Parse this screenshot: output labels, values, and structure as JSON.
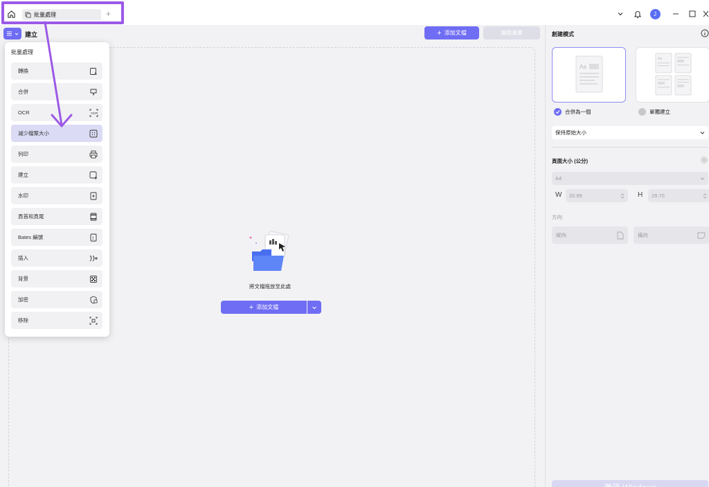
{
  "titlebar": {
    "tab_label": "批量處理",
    "tab_add": "+",
    "avatar_letter": "J"
  },
  "toolbar": {
    "page_title": "建立",
    "add_file_label": "添加文檔",
    "clear_list_label": "清除清單"
  },
  "dropzone": {
    "text": "將文檔拖放至此處",
    "add_file_label": "添加文檔"
  },
  "menu": {
    "header": "批量處理",
    "items": [
      {
        "label": "轉換",
        "icon": "convert-icon"
      },
      {
        "label": "合併",
        "icon": "merge-icon"
      },
      {
        "label": "OCR",
        "icon": "ocr-icon"
      },
      {
        "label": "減少檔案大小",
        "icon": "compress-icon"
      },
      {
        "label": "列印",
        "icon": "printer-icon"
      },
      {
        "label": "建立",
        "icon": "create-icon"
      },
      {
        "label": "水印",
        "icon": "watermark-icon"
      },
      {
        "label": "頁首和頁尾",
        "icon": "header-footer-icon"
      },
      {
        "label": "Bates 編號",
        "icon": "bates-icon"
      },
      {
        "label": "插入",
        "icon": "insert-icon"
      },
      {
        "label": "背景",
        "icon": "background-icon"
      },
      {
        "label": "加密",
        "icon": "encrypt-icon"
      },
      {
        "label": "移除",
        "icon": "remove-icon"
      }
    ],
    "active_index": 3
  },
  "right_panel": {
    "title": "創建模式",
    "merge_one_label": "合併為一個",
    "separate_label": "單獨建立",
    "keep_size_label": "保持原始大小",
    "page_size_label": "頁面大小 (公分)",
    "paper_size": "A4",
    "w_label": "W",
    "w_value": "20.99",
    "h_label": "H",
    "h_value": "29.70",
    "orientation_label": "方向",
    "portrait_label": "縱向",
    "landscape_label": "橫向",
    "apply_label": "激活 Windows"
  },
  "colors": {
    "accent": "#6f6df3",
    "highlight": "#9b59e6"
  }
}
